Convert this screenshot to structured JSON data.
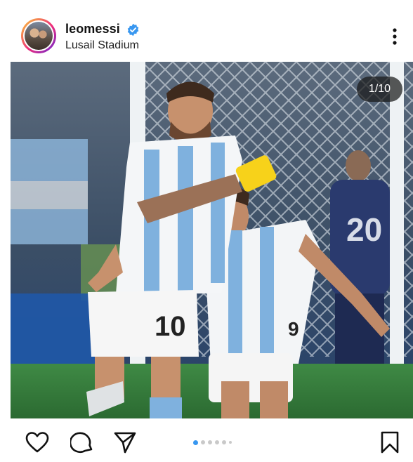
{
  "post": {
    "username": "leomessi",
    "verified": true,
    "location": "Lusail Stadium",
    "slide_counter": "1/10",
    "carousel": {
      "total_dots_visible": 6,
      "active_index": 0
    },
    "photo": {
      "description_icon": "photo",
      "jersey_number_primary": "10",
      "jersey_number_secondary": "9",
      "background_number": "20"
    }
  },
  "actions": {
    "like_icon": "heart-icon",
    "comment_icon": "comment-icon",
    "share_icon": "send-icon",
    "save_icon": "bookmark-icon"
  },
  "colors": {
    "verified_blue": "#3897f0",
    "active_dot": "#3897f0",
    "albiceleste": "#75aadb"
  }
}
